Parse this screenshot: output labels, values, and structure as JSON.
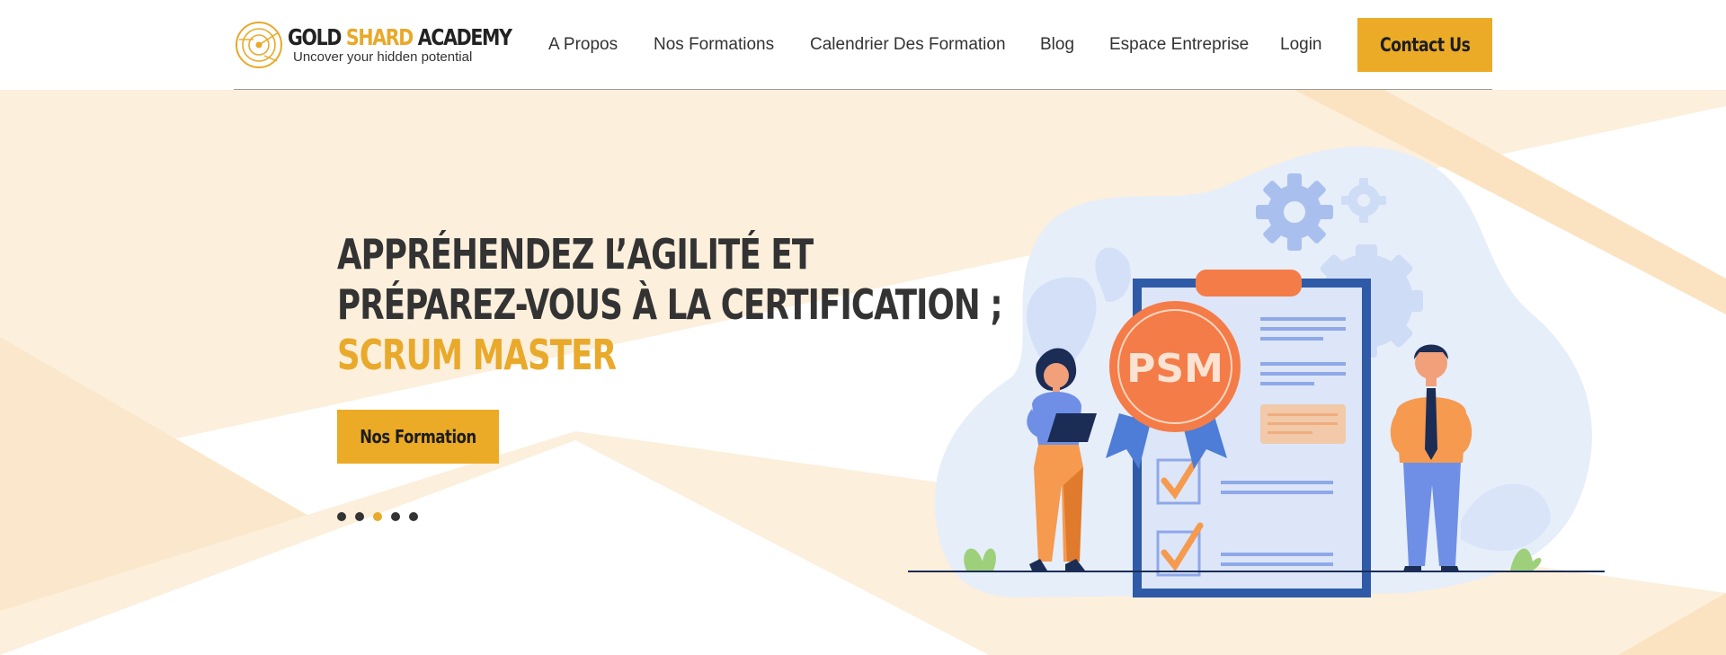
{
  "brand": {
    "name_part1": "GOLD ",
    "name_part2": "SHARD",
    "name_part3": " ACADEMY",
    "tagline": "Uncover your hidden potential",
    "accent_color": "#e9a92a",
    "logo_icon": "target-logo-icon"
  },
  "nav": {
    "items": [
      {
        "label": "A Propos"
      },
      {
        "label": "Nos Formations"
      },
      {
        "label": "Calendrier Des Formation"
      },
      {
        "label": "Blog"
      },
      {
        "label": "Espace Entreprise"
      },
      {
        "label": "Login"
      }
    ],
    "contact_label": "Contact Us"
  },
  "hero": {
    "line1": "APPRÉHENDEZ L’AGILITÉ ET",
    "line2": "PRÉPAREZ-VOUS À LA CERTIFICATION ;",
    "line3": "SCRUM MASTER",
    "cta_label": "Nos Formation",
    "slides_total": 5,
    "active_slide": 3,
    "badge_text": "PSM"
  },
  "colors": {
    "accent": "#ebab26",
    "text": "#333333",
    "bg_tint": "#fcefdc"
  }
}
